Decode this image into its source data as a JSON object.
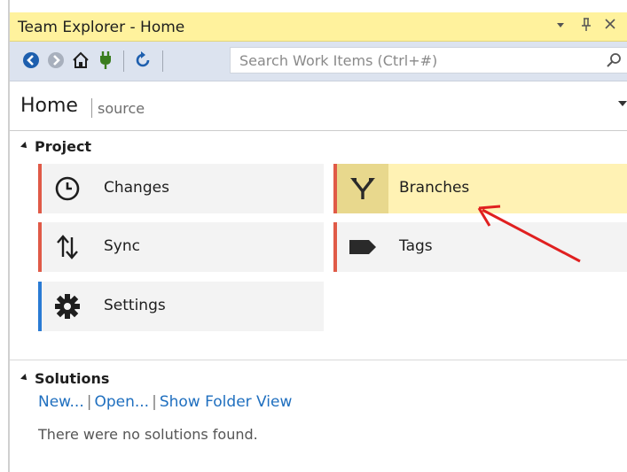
{
  "window": {
    "title": "Team Explorer - Home",
    "pin_glyph": "–#",
    "close_glyph": "✕"
  },
  "toolbar": {
    "search_placeholder": "Search Work Items (Ctrl+#)",
    "icons": [
      "back-icon",
      "forward-icon",
      "home-icon",
      "connect-icon",
      "refresh-icon",
      "search-icon"
    ]
  },
  "header": {
    "title": "Home",
    "subtitle": "source"
  },
  "project": {
    "title": "Project",
    "tiles": [
      {
        "label": "Changes",
        "icon": "clock-icon"
      },
      {
        "label": "Branches",
        "icon": "branch-icon"
      },
      {
        "label": "Sync",
        "icon": "sync-arrows-icon"
      },
      {
        "label": "Tags",
        "icon": "tag-icon"
      },
      {
        "label": "Settings",
        "icon": "gear-icon"
      }
    ]
  },
  "solutions": {
    "title": "Solutions",
    "links": [
      "New...",
      "Open...",
      "Show Folder View"
    ],
    "empty_message": "There were no solutions found."
  },
  "colors": {
    "title_bar": "#fff29d",
    "toolbar": "#dce3ef",
    "tile_accent_red": "#e05a47",
    "tile_accent_blue": "#2a7bd4",
    "highlight": "#fff2b4",
    "link": "#1f6fbf",
    "annotation_arrow": "#e02020"
  }
}
